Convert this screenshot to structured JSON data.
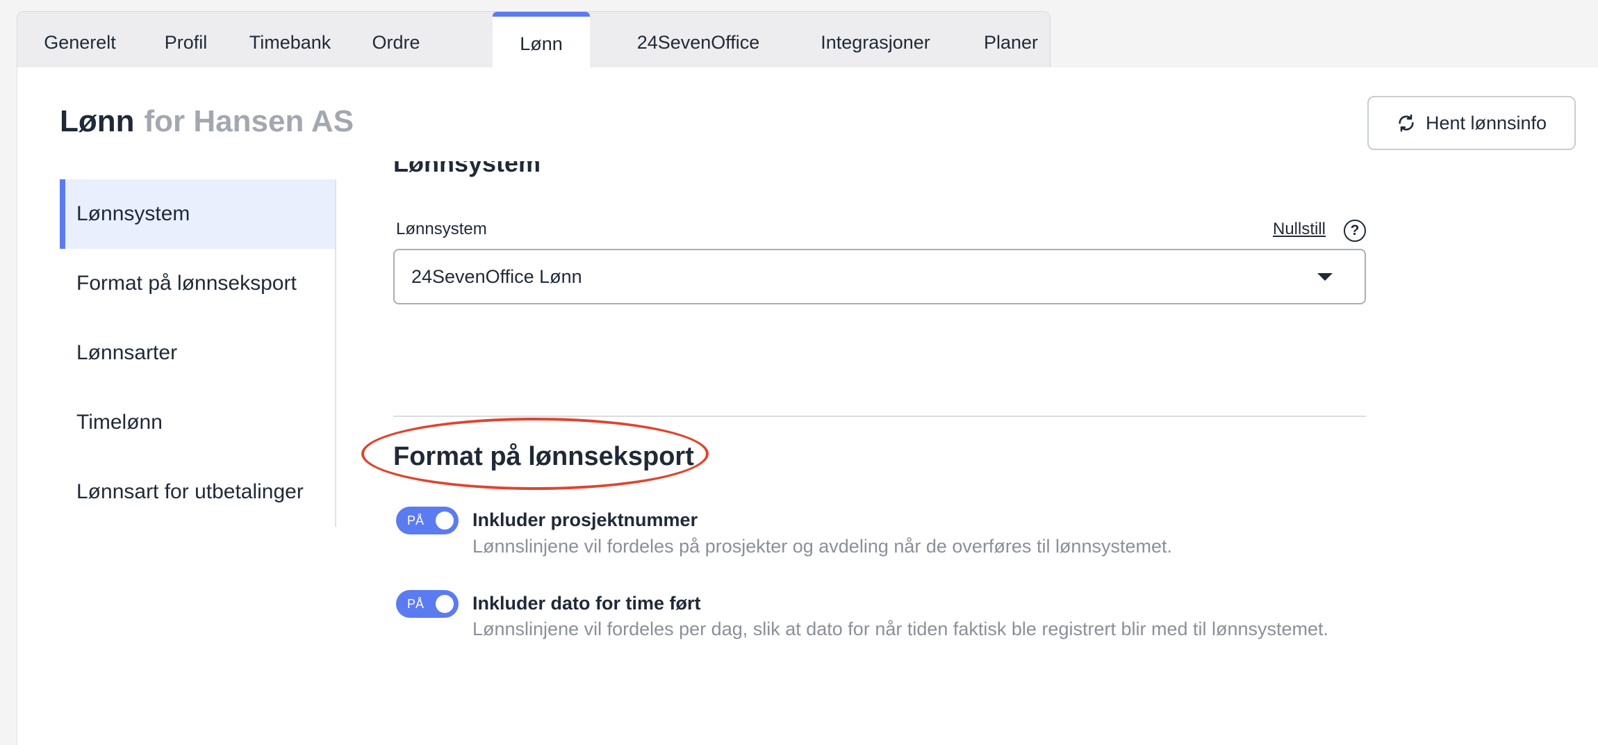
{
  "tabs": [
    {
      "label": "Generelt"
    },
    {
      "label": "Profil"
    },
    {
      "label": "Timebank"
    },
    {
      "label": "Ordre"
    },
    {
      "label": "Lønn",
      "active": true
    },
    {
      "label": "24SevenOffice"
    },
    {
      "label": "Integrasjoner"
    },
    {
      "label": "Planer"
    }
  ],
  "header": {
    "title": "Lønn",
    "company": "for Hansen AS",
    "fetch_button": "Hent lønnsinfo"
  },
  "sidenav": {
    "items": [
      {
        "label": "Lønnsystem",
        "active": true
      },
      {
        "label": "Format på lønnseksport"
      },
      {
        "label": "Lønnsarter"
      },
      {
        "label": "Timelønn"
      },
      {
        "label": "Lønnsart for utbetalinger"
      }
    ]
  },
  "lonnsystem": {
    "section_title": "Lønnsystem",
    "field_label": "Lønnsystem",
    "reset_link": "Nullstill",
    "help": "?",
    "selected_value": "24SevenOffice Lønn"
  },
  "format": {
    "section_title": "Format på lønnseksport",
    "options": [
      {
        "toggle_label": "PÅ",
        "enabled": true,
        "title": "Inkluder prosjektnummer",
        "description": "Lønnslinjene vil fordeles på prosjekter og avdeling når de overføres til lønnsystemet."
      },
      {
        "toggle_label": "PÅ",
        "enabled": true,
        "title": "Inkluder dato for time ført",
        "description": "Lønnslinjene vil fordeles per dag, slik at dato for når tiden faktisk ble registrert blir med til lønnsystemet."
      }
    ]
  },
  "colors": {
    "accent": "#5b7bf0",
    "highlight_ring": "#e0442c",
    "active_nav_bg": "#e9effd"
  }
}
